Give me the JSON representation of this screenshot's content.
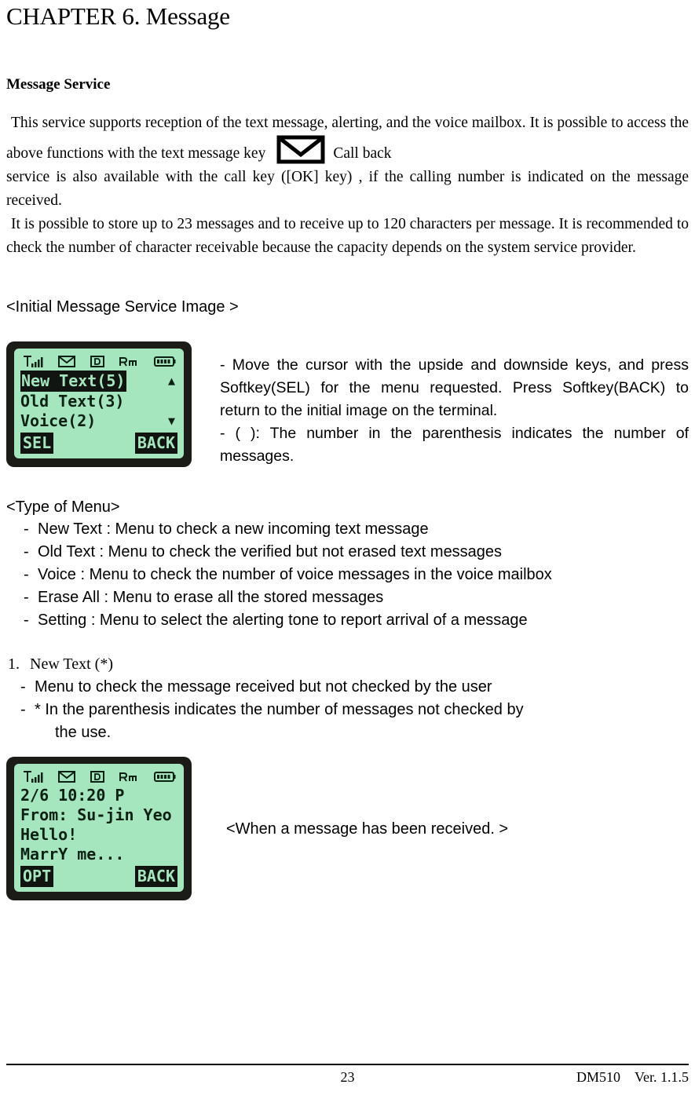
{
  "document": {
    "chapter_title": "CHAPTER 6. Message",
    "section_heading": "Message Service"
  },
  "intro": {
    "para1_part1": "This service supports reception of the text message, alerting, and the voice mailbox. It is possible to access the above functions with the text message key",
    "envelope_icon": "envelope-icon",
    "para1_part2": "Call back",
    "para2": "service is also available with the call key ([OK] key) , if the calling number is indicated on the message received.",
    "para3": "It is possible to store up to 23 messages and to receive up to 120 characters per message. It is recommended to check the number of character receivable because the capacity depends on the system service provider."
  },
  "initial_image": {
    "caption": "<Initial Message Service Image >",
    "lcd": {
      "status_icons": [
        "signal-icon",
        "envelope-icon",
        "data-d-icon",
        "roaming-rm-icon",
        "battery-icon"
      ],
      "lines": [
        {
          "text": "New Text(5)",
          "inverted": true,
          "arrow": "▲"
        },
        {
          "text": "Old Text(3)",
          "inverted": false,
          "arrow": ""
        },
        {
          "text": "Voice(2)",
          "inverted": false,
          "arrow": "▼"
        }
      ],
      "softkey_left": "SEL",
      "softkey_right": "BACK"
    },
    "description": [
      "- Move the cursor with the upside and downside keys, and press Softkey(SEL) for the menu requested. Press Softkey(BACK) to return to the initial image on the terminal.",
      "-    (  ): The number in the parenthesis indicates the number of messages."
    ]
  },
  "type_of_menu": {
    "caption": "<Type of Menu>",
    "dash": "-",
    "items": [
      "New Text : Menu to check a new incoming text message",
      "Old Text : Menu to check the verified but not erased text messages",
      "Voice : Menu to check the number of voice messages in the voice mailbox",
      "Erase All : Menu to erase all the stored messages",
      "Setting : Menu to select the alerting tone to report arrival of a message"
    ]
  },
  "new_text_section": {
    "number": "1.",
    "title": "New Text (*)",
    "dash": "-",
    "bullet1": "Menu to check the message received but not checked by the user",
    "bullet2": "* In the parenthesis indicates the number of messages not checked by",
    "bullet2_cont": "the use."
  },
  "received_image": {
    "lcd": {
      "status_icons": [
        "signal-icon",
        "envelope-icon",
        "data-d-icon",
        "roaming-rm-icon",
        "battery-icon"
      ],
      "lines": [
        "2/6 10:20 P",
        "From: Su-jin Yeo",
        "Hello!",
        "MarrY me..."
      ],
      "softkey_left": "OPT",
      "softkey_right": "BACK"
    },
    "caption": "<When a message has been received. >"
  },
  "footer": {
    "page_number": "23",
    "model": "DM510",
    "version": "Ver. 1.1.5"
  },
  "colors": {
    "lcd_background": "#a6e6bf",
    "lcd_text": "#0b2114",
    "lcd_bezel": "#1b1b18"
  }
}
